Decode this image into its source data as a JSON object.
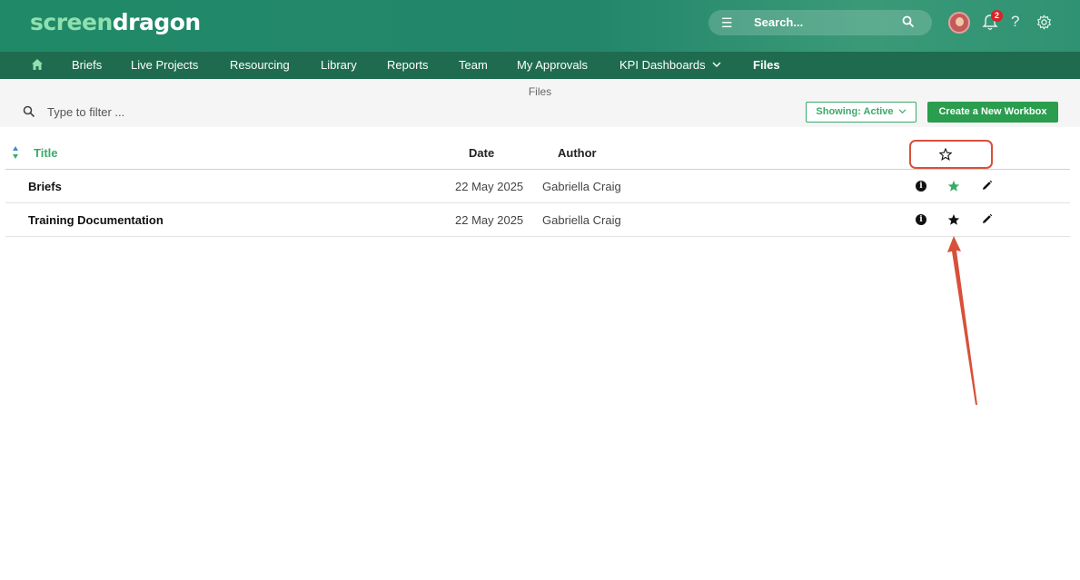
{
  "header": {
    "logo_part1": "screen",
    "logo_part2": "dragon",
    "search_placeholder": "Search...",
    "notification_count": "2",
    "help_label": "?"
  },
  "nav": {
    "items": [
      "Briefs",
      "Live Projects",
      "Resourcing",
      "Library",
      "Reports",
      "Team",
      "My Approvals",
      "KPI Dashboards",
      "Files"
    ],
    "active": "Files"
  },
  "page": {
    "title": "Files",
    "filter_placeholder": "Type to filter ...",
    "showing_label": "Showing: Active",
    "create_label": "Create a New Workbox"
  },
  "table": {
    "columns": {
      "title": "Title",
      "date": "Date",
      "author": "Author"
    },
    "rows": [
      {
        "name": "Briefs",
        "date": "22 May 2025",
        "author": "Gabriella Craig",
        "starred": true
      },
      {
        "name": "Training Documentation",
        "date": "22 May 2025",
        "author": "Gabriella Craig",
        "starred": false
      }
    ]
  },
  "colors": {
    "brand_green": "#228868",
    "nav_green": "#1e6b4f",
    "accent_green": "#3aaa6a",
    "annotation_red": "#d9503a"
  }
}
